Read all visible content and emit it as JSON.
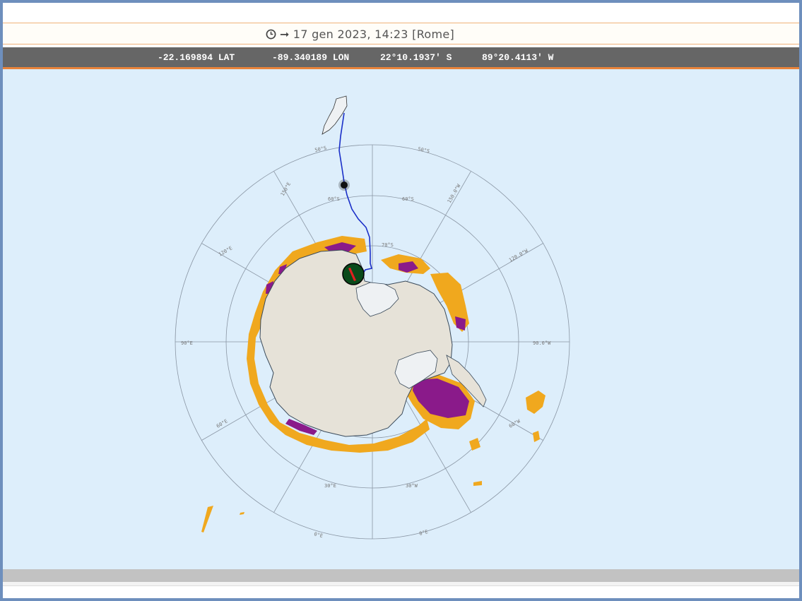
{
  "header": {
    "datetime": "17 gen 2023, 14:23 [Rome]"
  },
  "coordinates": {
    "lat_decimal": "-22.169894 LAT",
    "lon_decimal": "-89.340189 LON",
    "lat_dms": "22°10.1937' S",
    "lon_dms": "89°20.4113' W"
  },
  "map": {
    "projection": "south polar stereographic",
    "grid_labels": [
      "50°S",
      "60°S",
      "70°S",
      "90°E",
      "90.0°W",
      "120°E",
      "120.0°W",
      "150°E",
      "150.0°W",
      "30°E",
      "30°W",
      "60°E",
      "60°W",
      "0°E"
    ],
    "colors": {
      "ocean": "#ddeefb",
      "land": "#e6e2d8",
      "ice_shelf": "#eef1f3",
      "route": "#1a2fc8",
      "sea_ice_low": "#f0a81e",
      "sea_ice_high": "#8a1a8a",
      "vessel_marker": "#0a4a1a",
      "vessel_arrow": "#e02020"
    },
    "icons": [
      "vessel-marker-icon",
      "position-dot-icon"
    ]
  }
}
